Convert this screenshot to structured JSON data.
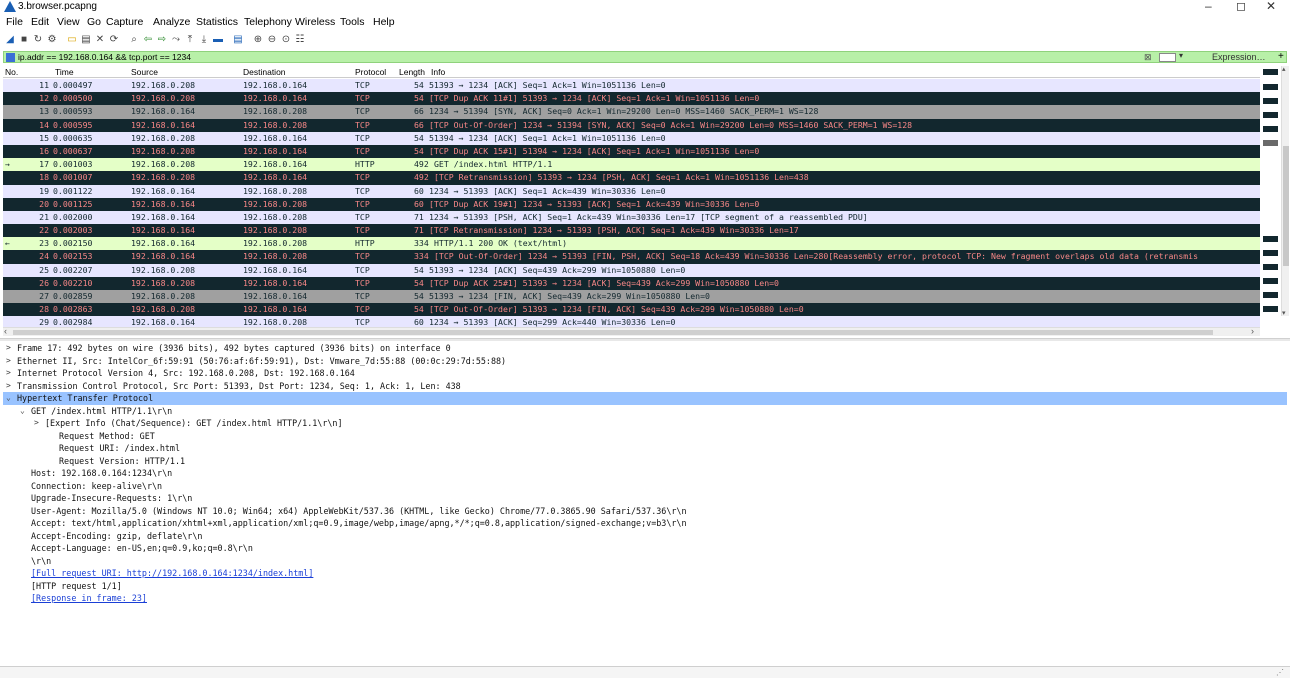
{
  "window": {
    "title": "3.browser.pcapng",
    "minimize": "–",
    "maximize": "◻",
    "close": "✕"
  },
  "menu": [
    "File",
    "Edit",
    "View",
    "Go",
    "Capture",
    "Analyze",
    "Statistics",
    "Telephony",
    "Wireless",
    "Tools",
    "Help"
  ],
  "toolbar_icons": [
    "shark-fin-icon",
    "stop-icon",
    "restart-icon",
    "options-icon",
    "open-icon",
    "save-icon",
    "close-file-icon",
    "reload-icon",
    "find-icon",
    "back-icon",
    "forward-icon",
    "goto-icon",
    "first-icon",
    "last-icon",
    "autoscroll-icon",
    "colorize-icon",
    "zoom-in-icon",
    "zoom-out-icon",
    "zoom-normal-icon",
    "resize-columns-icon"
  ],
  "filter": {
    "value": "ip.addr == 192.168.0.164 && tcp.port == 1234",
    "clear": "⊠",
    "dropdown": "▾",
    "expression_label": "Expression…",
    "plus": "+"
  },
  "columns": [
    "No.",
    "Time",
    "Source",
    "Destination",
    "Protocol",
    "Length",
    "Info"
  ],
  "packets": [
    {
      "no": "11",
      "time": "0.000497",
      "src": "192.168.0.208",
      "dst": "192.168.0.164",
      "proto": "TCP",
      "len": "54",
      "info": "51393 → 1234 [ACK] Seq=1 Ack=1 Win=1051136 Len=0",
      "style": "tcp",
      "marker": ""
    },
    {
      "no": "12",
      "time": "0.000500",
      "src": "192.168.0.208",
      "dst": "192.168.0.164",
      "proto": "TCP",
      "len": "54",
      "info": "[TCP Dup ACK 11#1] 51393 → 1234 [ACK] Seq=1 Ack=1 Win=1051136 Len=0",
      "style": "bad",
      "marker": ""
    },
    {
      "no": "13",
      "time": "0.000593",
      "src": "192.168.0.164",
      "dst": "192.168.0.208",
      "proto": "TCP",
      "len": "66",
      "info": "1234 → 51394 [SYN, ACK] Seq=0 Ack=1 Win=29200 Len=0 MSS=1460 SACK_PERM=1 WS=128",
      "style": "syn",
      "marker": ""
    },
    {
      "no": "14",
      "time": "0.000595",
      "src": "192.168.0.164",
      "dst": "192.168.0.208",
      "proto": "TCP",
      "len": "66",
      "info": "[TCP Out-Of-Order] 1234 → 51394 [SYN, ACK] Seq=0 Ack=1 Win=29200 Len=0 MSS=1460 SACK_PERM=1 WS=128",
      "style": "bad",
      "marker": ""
    },
    {
      "no": "15",
      "time": "0.000635",
      "src": "192.168.0.208",
      "dst": "192.168.0.164",
      "proto": "TCP",
      "len": "54",
      "info": "51394 → 1234 [ACK] Seq=1 Ack=1 Win=1051136 Len=0",
      "style": "tcp",
      "marker": ""
    },
    {
      "no": "16",
      "time": "0.000637",
      "src": "192.168.0.208",
      "dst": "192.168.0.164",
      "proto": "TCP",
      "len": "54",
      "info": "[TCP Dup ACK 15#1] 51394 → 1234 [ACK] Seq=1 Ack=1 Win=1051136 Len=0",
      "style": "bad",
      "marker": ""
    },
    {
      "no": "17",
      "time": "0.001003",
      "src": "192.168.0.208",
      "dst": "192.168.0.164",
      "proto": "HTTP",
      "len": "492",
      "info": "GET /index.html HTTP/1.1",
      "style": "http",
      "marker": "→"
    },
    {
      "no": "18",
      "time": "0.001007",
      "src": "192.168.0.208",
      "dst": "192.168.0.164",
      "proto": "TCP",
      "len": "492",
      "info": "[TCP Retransmission] 51393 → 1234 [PSH, ACK] Seq=1 Ack=1 Win=1051136 Len=438",
      "style": "bad",
      "marker": ""
    },
    {
      "no": "19",
      "time": "0.001122",
      "src": "192.168.0.164",
      "dst": "192.168.0.208",
      "proto": "TCP",
      "len": "60",
      "info": "1234 → 51393 [ACK] Seq=1 Ack=439 Win=30336 Len=0",
      "style": "tcp",
      "marker": ""
    },
    {
      "no": "20",
      "time": "0.001125",
      "src": "192.168.0.164",
      "dst": "192.168.0.208",
      "proto": "TCP",
      "len": "60",
      "info": "[TCP Dup ACK 19#1] 1234 → 51393 [ACK] Seq=1 Ack=439 Win=30336 Len=0",
      "style": "bad",
      "marker": ""
    },
    {
      "no": "21",
      "time": "0.002000",
      "src": "192.168.0.164",
      "dst": "192.168.0.208",
      "proto": "TCP",
      "len": "71",
      "info": "1234 → 51393 [PSH, ACK] Seq=1 Ack=439 Win=30336 Len=17 [TCP segment of a reassembled PDU]",
      "style": "tcp",
      "marker": ""
    },
    {
      "no": "22",
      "time": "0.002003",
      "src": "192.168.0.164",
      "dst": "192.168.0.208",
      "proto": "TCP",
      "len": "71",
      "info": "[TCP Retransmission] 1234 → 51393 [PSH, ACK] Seq=1 Ack=439 Win=30336 Len=17",
      "style": "bad",
      "marker": ""
    },
    {
      "no": "23",
      "time": "0.002150",
      "src": "192.168.0.164",
      "dst": "192.168.0.208",
      "proto": "HTTP",
      "len": "334",
      "info": "HTTP/1.1 200 OK  (text/html)",
      "style": "http",
      "marker": "←"
    },
    {
      "no": "24",
      "time": "0.002153",
      "src": "192.168.0.164",
      "dst": "192.168.0.208",
      "proto": "TCP",
      "len": "334",
      "info": "[TCP Out-Of-Order] 1234 → 51393 [FIN, PSH, ACK] Seq=18 Ack=439 Win=30336 Len=280[Reassembly error, protocol TCP: New fragment overlaps old data (retransmis",
      "style": "bad",
      "marker": ""
    },
    {
      "no": "25",
      "time": "0.002207",
      "src": "192.168.0.208",
      "dst": "192.168.0.164",
      "proto": "TCP",
      "len": "54",
      "info": "51393 → 1234 [ACK] Seq=439 Ack=299 Win=1050880 Len=0",
      "style": "tcp",
      "marker": ""
    },
    {
      "no": "26",
      "time": "0.002210",
      "src": "192.168.0.208",
      "dst": "192.168.0.164",
      "proto": "TCP",
      "len": "54",
      "info": "[TCP Dup ACK 25#1] 51393 → 1234 [ACK] Seq=439 Ack=299 Win=1050880 Len=0",
      "style": "bad",
      "marker": ""
    },
    {
      "no": "27",
      "time": "0.002859",
      "src": "192.168.0.208",
      "dst": "192.168.0.164",
      "proto": "TCP",
      "len": "54",
      "info": "51393 → 1234 [FIN, ACK] Seq=439 Ack=299 Win=1050880 Len=0",
      "style": "syn",
      "marker": ""
    },
    {
      "no": "28",
      "time": "0.002863",
      "src": "192.168.0.208",
      "dst": "192.168.0.164",
      "proto": "TCP",
      "len": "54",
      "info": "[TCP Out-Of-Order] 51393 → 1234 [FIN, ACK] Seq=439 Ack=299 Win=1050880 Len=0",
      "style": "bad",
      "marker": ""
    },
    {
      "no": "29",
      "time": "0.002984",
      "src": "192.168.0.164",
      "dst": "192.168.0.208",
      "proto": "TCP",
      "len": "60",
      "info": "1234 → 51393 [ACK] Seq=299 Ack=440 Win=30336 Len=0",
      "style": "tcp",
      "marker": ""
    }
  ],
  "details": [
    {
      "indent": 0,
      "arrow": ">",
      "text": "Frame 17: 492 bytes on wire (3936 bits), 492 bytes captured (3936 bits) on interface 0",
      "selected": false,
      "link": false
    },
    {
      "indent": 0,
      "arrow": ">",
      "text": "Ethernet II, Src: IntelCor_6f:59:91 (50:76:af:6f:59:91), Dst: Vmware_7d:55:88 (00:0c:29:7d:55:88)",
      "selected": false,
      "link": false
    },
    {
      "indent": 0,
      "arrow": ">",
      "text": "Internet Protocol Version 4, Src: 192.168.0.208, Dst: 192.168.0.164",
      "selected": false,
      "link": false
    },
    {
      "indent": 0,
      "arrow": ">",
      "text": "Transmission Control Protocol, Src Port: 51393, Dst Port: 1234, Seq: 1, Ack: 1, Len: 438",
      "selected": false,
      "link": false
    },
    {
      "indent": 0,
      "arrow": "⌄",
      "text": "Hypertext Transfer Protocol",
      "selected": true,
      "link": false
    },
    {
      "indent": 1,
      "arrow": "⌄",
      "text": "GET /index.html HTTP/1.1\\r\\n",
      "selected": false,
      "link": false
    },
    {
      "indent": 2,
      "arrow": ">",
      "text": "[Expert Info (Chat/Sequence): GET /index.html HTTP/1.1\\r\\n]",
      "selected": false,
      "link": false
    },
    {
      "indent": 3,
      "arrow": "",
      "text": "Request Method: GET",
      "selected": false,
      "link": false
    },
    {
      "indent": 3,
      "arrow": "",
      "text": "Request URI: /index.html",
      "selected": false,
      "link": false
    },
    {
      "indent": 3,
      "arrow": "",
      "text": "Request Version: HTTP/1.1",
      "selected": false,
      "link": false
    },
    {
      "indent": 1,
      "arrow": "",
      "text": "Host: 192.168.0.164:1234\\r\\n",
      "selected": false,
      "link": false
    },
    {
      "indent": 1,
      "arrow": "",
      "text": "Connection: keep-alive\\r\\n",
      "selected": false,
      "link": false
    },
    {
      "indent": 1,
      "arrow": "",
      "text": "Upgrade-Insecure-Requests: 1\\r\\n",
      "selected": false,
      "link": false
    },
    {
      "indent": 1,
      "arrow": "",
      "text": "User-Agent: Mozilla/5.0 (Windows NT 10.0; Win64; x64) AppleWebKit/537.36 (KHTML, like Gecko) Chrome/77.0.3865.90 Safari/537.36\\r\\n",
      "selected": false,
      "link": false
    },
    {
      "indent": 1,
      "arrow": "",
      "text": "Accept: text/html,application/xhtml+xml,application/xml;q=0.9,image/webp,image/apng,*/*;q=0.8,application/signed-exchange;v=b3\\r\\n",
      "selected": false,
      "link": false
    },
    {
      "indent": 1,
      "arrow": "",
      "text": "Accept-Encoding: gzip, deflate\\r\\n",
      "selected": false,
      "link": false
    },
    {
      "indent": 1,
      "arrow": "",
      "text": "Accept-Language: en-US,en;q=0.9,ko;q=0.8\\r\\n",
      "selected": false,
      "link": false
    },
    {
      "indent": 1,
      "arrow": "",
      "text": "\\r\\n",
      "selected": false,
      "link": false
    },
    {
      "indent": 1,
      "arrow": "",
      "text": "[Full request URI: http://192.168.0.164:1234/index.html]",
      "selected": false,
      "link": true
    },
    {
      "indent": 1,
      "arrow": "",
      "text": "[HTTP request 1/1]",
      "selected": false,
      "link": false
    },
    {
      "indent": 1,
      "arrow": "",
      "text": "[Response in frame: 23]",
      "selected": false,
      "link": true
    }
  ],
  "colors": {
    "tcp_bg": "#e7e6ff",
    "bad_bg": "#12272e",
    "bad_fg": "#f78787",
    "syn_bg": "#a0a0a0",
    "http_bg": "#e4ffc7",
    "filter_bg": "#b8f0a8",
    "selected_detail": "#99c3ff"
  }
}
